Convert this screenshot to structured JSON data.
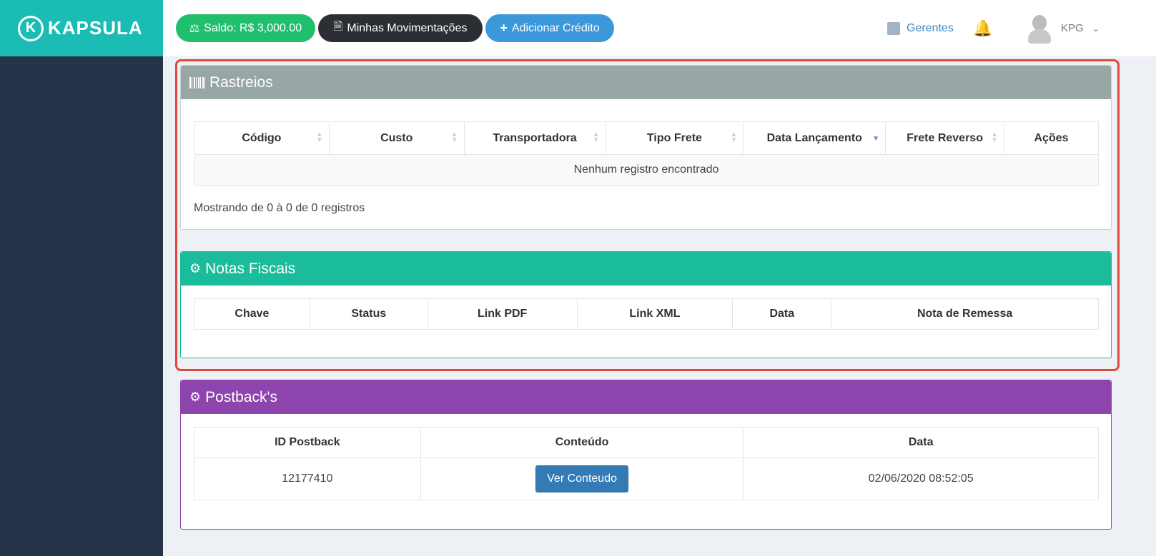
{
  "brand": {
    "name": "KAPSULA",
    "mark": "K"
  },
  "topbar": {
    "saldo": "Saldo: R$ 3,000.00",
    "movimentacoes": "Minhas Movimentações",
    "adicionar": "Adicionar Crédito",
    "gerentes": "Gerentes",
    "user": "KPG"
  },
  "rastreios": {
    "title": "Rastreios",
    "columns": [
      "Código",
      "Custo",
      "Transportadora",
      "Tipo Frete",
      "Data Lançamento",
      "Frete Reverso",
      "Ações"
    ],
    "empty": "Nenhum registro encontrado",
    "info": "Mostrando de 0 à 0 de 0 registros"
  },
  "notas": {
    "title": "Notas Fiscais",
    "columns": [
      "Chave",
      "Status",
      "Link PDF",
      "Link XML",
      "Data",
      "Nota de Remessa"
    ]
  },
  "postbacks": {
    "title": "Postback's",
    "columns": [
      "ID Postback",
      "Conteúdo",
      "Data"
    ],
    "rows": [
      {
        "id": "12177410",
        "button": "Ver Conteudo",
        "date": "02/06/2020 08:52:05"
      }
    ]
  },
  "colors": {
    "sidebar": "#263247",
    "brand": "#1bbcb3",
    "saldo": "#1fbf6e",
    "movimentacoes": "#2b2f33",
    "adicionar": "#3a98db",
    "rastreios_header": "#98a6a5",
    "notas_header": "#1bbc9b",
    "postbacks_header": "#8e44ad",
    "highlight": "#e0483a"
  }
}
